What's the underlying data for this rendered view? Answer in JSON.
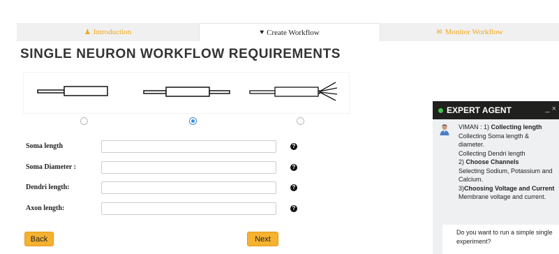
{
  "tabs": [
    {
      "label": "Introduction",
      "icon": "user-icon"
    },
    {
      "label": "Create Workflow",
      "icon": "heart-icon"
    },
    {
      "label": "Monitor Workflow",
      "icon": "envelope-icon"
    }
  ],
  "page_title": "SINGLE NEURON WORKFLOW REQUIREMENTS",
  "neuron_options": {
    "selected_index": 1,
    "options": [
      "soma-only",
      "soma-with-dendrite",
      "soma-with-branching-dendrites"
    ]
  },
  "form": {
    "fields": [
      {
        "label": "Soma length",
        "value": ""
      },
      {
        "label": "Soma Diameter :",
        "value": ""
      },
      {
        "label": "Dendri length:",
        "value": ""
      },
      {
        "label": "Axon length:",
        "value": ""
      }
    ],
    "help_glyph": "?"
  },
  "buttons": {
    "back": "Back",
    "next": "Next"
  },
  "chat": {
    "title": "EXPERT AGENT",
    "status_color": "#3fc14b",
    "controls": "_ ×",
    "agent_name": "VIMAN : ",
    "message": {
      "step1_prefix": "1) ",
      "step1_title": "Collecting length",
      "step1_line1": "Collecting Soma length & diameter.",
      "step1_line2": "Collecting Dendri length",
      "step2_prefix": "2) ",
      "step2_title": "Choose Channels",
      "step2_line1": "Selecting Sodium, Potassium and Calcium.",
      "step3_prefix": "3)",
      "step3_title": "Choosing Voltage and Current",
      "step3_line1": "Membrane voltage and current."
    },
    "prompt": "Do you want to run a simple single experiment?"
  },
  "colors": {
    "accent": "#f5b130",
    "tab_text": "#f0a81e",
    "radio_selected": "#3b8de0"
  }
}
